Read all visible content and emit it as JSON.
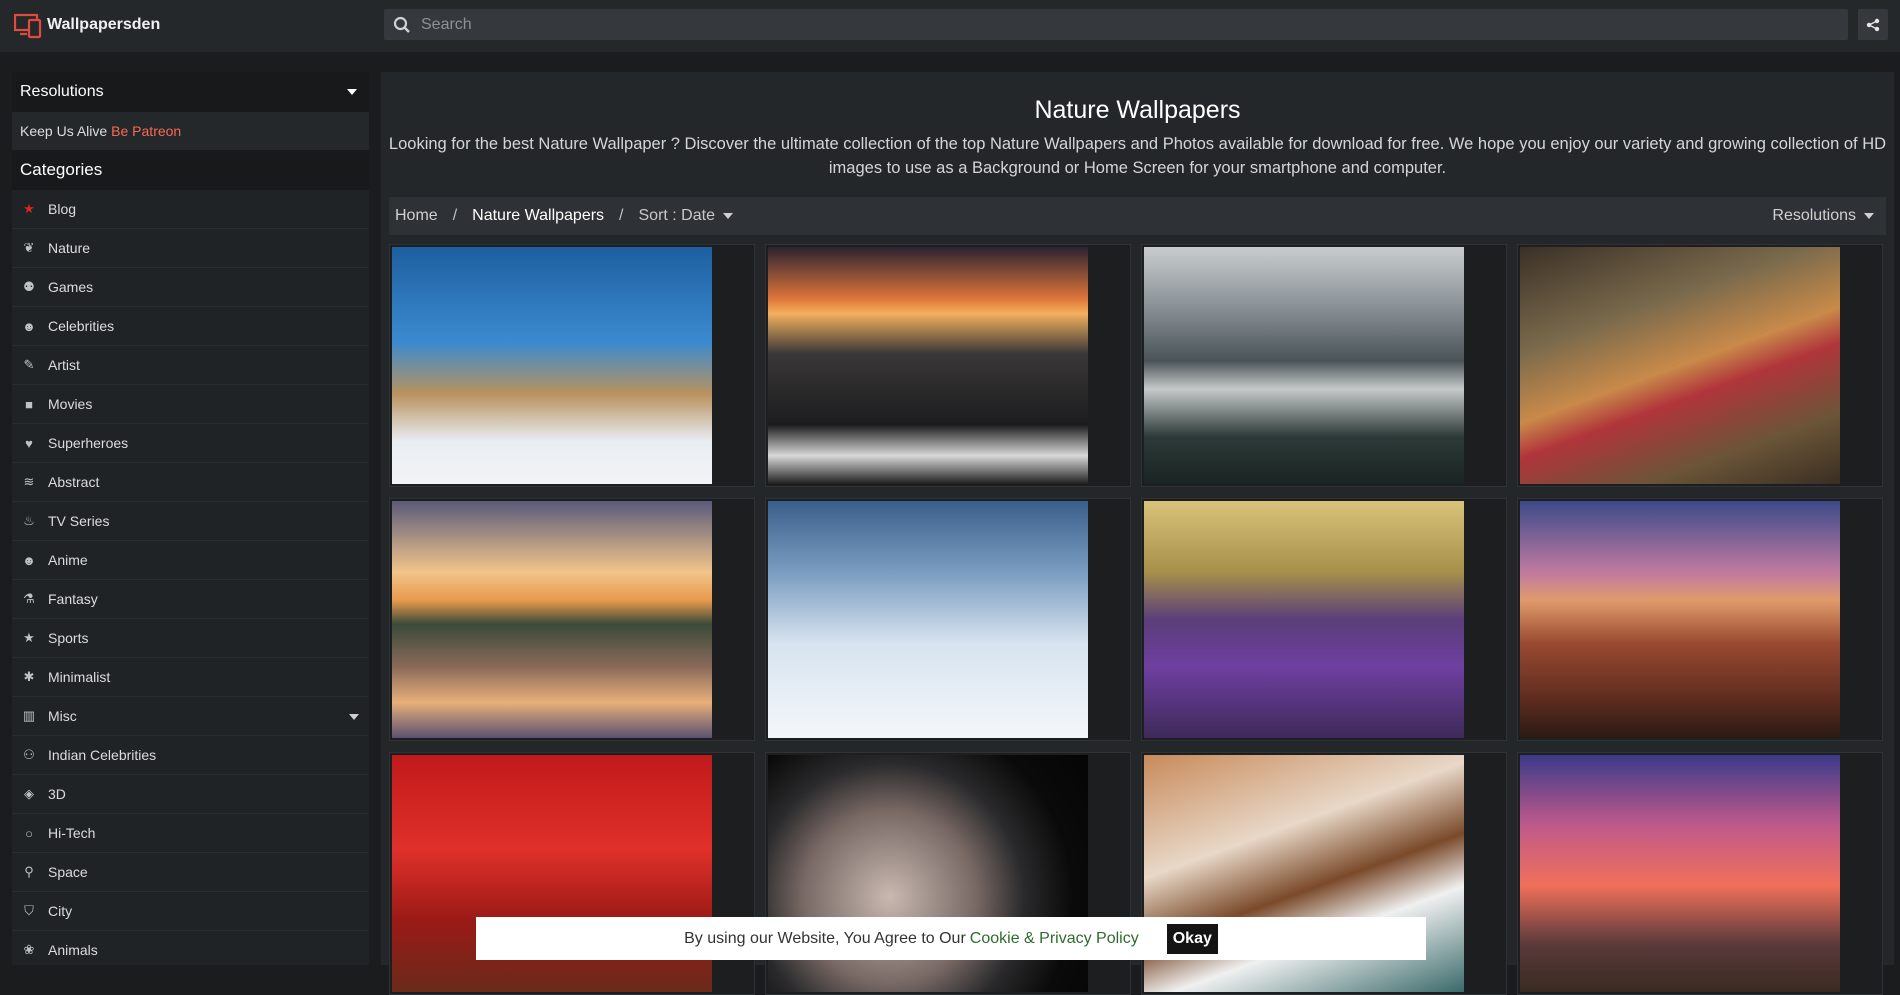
{
  "site": {
    "name": "Wallpapersden",
    "logo_icon": "devices-logo-icon"
  },
  "search": {
    "placeholder": "Search",
    "value": ""
  },
  "sidebar": {
    "resolutions_label": "Resolutions",
    "patreon_text": "Keep Us Alive",
    "patreon_link": "Be Patreon",
    "categories_label": "Categories",
    "items": [
      {
        "label": "Blog",
        "icon": "star-icon"
      },
      {
        "label": "Nature",
        "icon": "leaf-icon"
      },
      {
        "label": "Games",
        "icon": "gamepad-icon"
      },
      {
        "label": "Celebrities",
        "icon": "smile-icon"
      },
      {
        "label": "Artist",
        "icon": "brush-icon"
      },
      {
        "label": "Movies",
        "icon": "video-icon"
      },
      {
        "label": "Superheroes",
        "icon": "heart-icon"
      },
      {
        "label": "Abstract",
        "icon": "layers-icon"
      },
      {
        "label": "TV Series",
        "icon": "fire-icon"
      },
      {
        "label": "Anime",
        "icon": "face-icon"
      },
      {
        "label": "Fantasy",
        "icon": "wand-icon"
      },
      {
        "label": "Sports",
        "icon": "star-icon"
      },
      {
        "label": "Minimalist",
        "icon": "asterisk-icon"
      },
      {
        "label": "Misc",
        "icon": "building-icon"
      },
      {
        "label": "Indian Celebrities",
        "icon": "users-icon"
      },
      {
        "label": "3D",
        "icon": "cube-icon"
      },
      {
        "label": "Hi-Tech",
        "icon": "circle-icon"
      },
      {
        "label": "Space",
        "icon": "pin-icon"
      },
      {
        "label": "City",
        "icon": "shield-icon"
      },
      {
        "label": "Animals",
        "icon": "paw-icon"
      }
    ]
  },
  "main": {
    "title": "Nature Wallpapers",
    "description": "Looking for the best Nature Wallpaper ? Discover the ultimate collection of the top Nature Wallpapers and Photos available for download for free. We hope you enjoy our variety and growing collection of HD images to use as a Background or Home Screen for your smartphone and computer.",
    "breadcrumb": {
      "home": "Home",
      "current": "Nature Wallpapers",
      "sort": "Sort : Date",
      "resolutions": "Resolutions"
    },
    "wallpapers": [
      {
        "subject": "snowy mountain peak"
      },
      {
        "subject": "rocky coast sunset"
      },
      {
        "subject": "misty river valley"
      },
      {
        "subject": "winding mountain road"
      },
      {
        "subject": "lake island sunrise"
      },
      {
        "subject": "snow covered trees"
      },
      {
        "subject": "lavender field tree"
      },
      {
        "subject": "red rock arch"
      },
      {
        "subject": "red room window"
      },
      {
        "subject": "moon"
      },
      {
        "subject": "beach waves"
      },
      {
        "subject": "tree at sunset"
      }
    ]
  },
  "cookie": {
    "text": "By using our Website, You Agree to Our",
    "link": "Cookie & Privacy Policy",
    "ok": "Okay"
  },
  "colors": {
    "accent_patreon": "#f96854",
    "link_green": "#2f6b2f",
    "background": "#1a1c1e"
  }
}
